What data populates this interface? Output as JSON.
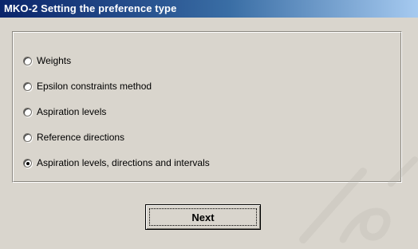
{
  "window": {
    "title": "MKO-2 Setting the preference type"
  },
  "preference_options": [
    {
      "label": "Weights",
      "selected": false
    },
    {
      "label": "Epsilon constraints method",
      "selected": false
    },
    {
      "label": "Aspiration levels",
      "selected": false
    },
    {
      "label": "Reference directions",
      "selected": false
    },
    {
      "label": "Aspiration levels, directions and intervals",
      "selected": true
    }
  ],
  "actions": {
    "next_label": "Next"
  }
}
